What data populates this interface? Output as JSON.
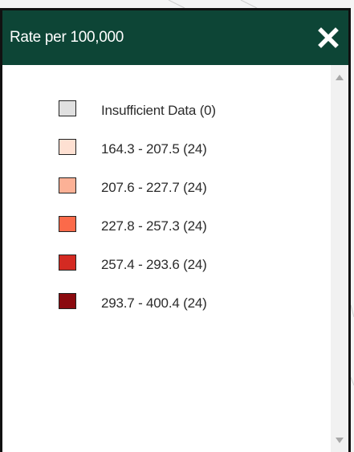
{
  "legend": {
    "title": "Rate per 100,000",
    "items": [
      {
        "label": "Insufficient Data (0)",
        "color": "#e0e0e0"
      },
      {
        "label": "164.3 - 207.5 (24)",
        "color": "#fee0d2"
      },
      {
        "label": "207.6 - 227.7 (24)",
        "color": "#fcb196"
      },
      {
        "label": "227.8 - 257.3 (24)",
        "color": "#fb6a4a"
      },
      {
        "label": "257.4 - 293.6 (24)",
        "color": "#d42a22"
      },
      {
        "label": "293.7 - 400.4 (24)",
        "color": "#8b0a0f"
      }
    ]
  },
  "colors": {
    "header_bg": "#0d4536",
    "header_text": "#ffffff",
    "panel_border": "#111111"
  },
  "icons": {
    "close": "close-icon",
    "scroll_up": "triangle-up-icon",
    "scroll_down": "triangle-down-icon"
  }
}
